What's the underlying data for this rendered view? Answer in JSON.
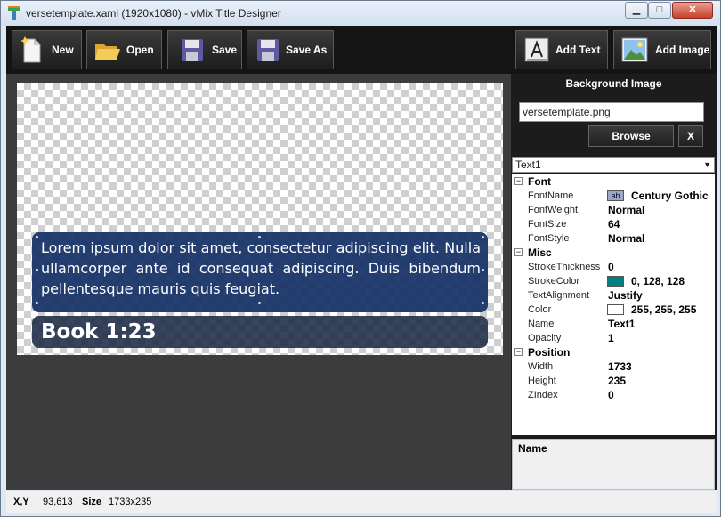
{
  "window": {
    "title": "versetemplate.xaml (1920x1080) - vMix Title Designer",
    "min_glyph": "▁",
    "max_glyph": "□",
    "close_glyph": "✕"
  },
  "toolbar": {
    "new_label": "New",
    "open_label": "Open",
    "save_label": "Save",
    "save_as_label": "Save As",
    "add_text_label": "Add Text",
    "add_image_label": "Add Image"
  },
  "canvas": {
    "verse_text": "Lorem ipsum dolor sit amet, consectetur adipiscing elit. Nulla ullamcorper ante id consequat adipiscing. Duis bibendum pellentesque mauris quis feugiat.",
    "reference_text": "Book 1:23"
  },
  "background_image": {
    "title": "Background Image",
    "file": "versetemplate.png",
    "browse_label": "Browse",
    "clear_label": "X"
  },
  "element_select": {
    "value": "Text1"
  },
  "properties": {
    "font": {
      "category": "Font",
      "toggle": "−",
      "font_name_key": "FontName",
      "font_name_chip": "ab",
      "font_name_value": "Century Gothic",
      "font_weight_key": "FontWeight",
      "font_weight_value": "Normal",
      "font_size_key": "FontSize",
      "font_size_value": "64",
      "font_style_key": "FontStyle",
      "font_style_value": "Normal"
    },
    "misc": {
      "category": "Misc",
      "toggle": "−",
      "stroke_thickness_key": "StrokeThickness",
      "stroke_thickness_value": "0",
      "stroke_color_key": "StrokeColor",
      "stroke_color_value": "0, 128, 128",
      "text_alignment_key": "TextAlignment",
      "text_alignment_value": "Justify",
      "color_key": "Color",
      "color_value": "255, 255, 255",
      "name_key": "Name",
      "name_value": "Text1",
      "opacity_key": "Opacity",
      "opacity_value": "1"
    },
    "position": {
      "category": "Position",
      "toggle": "−",
      "width_key": "Width",
      "width_value": "1733",
      "height_key": "Height",
      "height_value": "235",
      "zindex_key": "ZIndex",
      "zindex_value": "0"
    }
  },
  "description": {
    "title": "Name"
  },
  "status": {
    "xy_label": "X,Y",
    "xy_value": "93,613",
    "size_label": "Size",
    "size_value": "1733x235"
  },
  "colors": {
    "stroke_swatch": "#008080",
    "color_swatch": "#ffffff",
    "verse_box": "#163066",
    "toolbar_bg": "#141414",
    "panel_bg": "#1c1c1c"
  },
  "icons": [
    "app-icon",
    "new-file-icon",
    "folder-open-icon",
    "floppy-save-icon",
    "floppy-save-as-icon",
    "text-frame-icon",
    "picture-icon",
    "dropdown-arrow-icon"
  ]
}
